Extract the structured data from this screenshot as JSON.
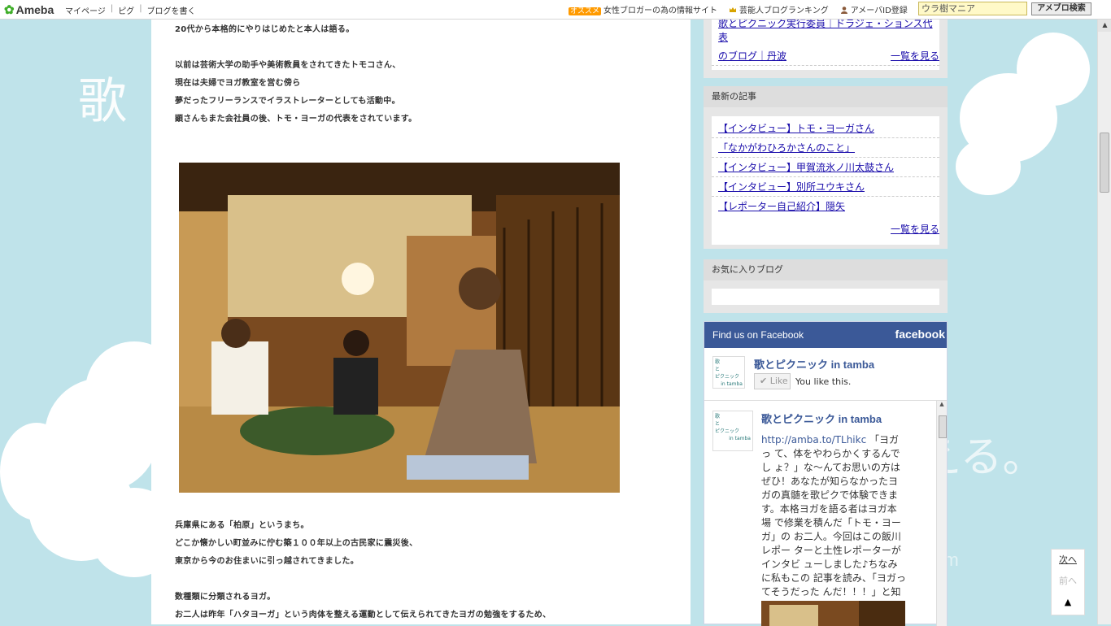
{
  "topbar": {
    "logo": "Ameba",
    "nav": [
      "マイページ",
      "ピグ",
      "ブログを書く"
    ],
    "links": [
      {
        "badge": "オススメ",
        "label": "女性ブロガーの為の情報サイト"
      },
      {
        "icon": "crown-icon",
        "label": "芸能人ブログランキング"
      },
      {
        "icon": "user-icon",
        "label": "アメーバID登録"
      }
    ],
    "search_value": "ウラ樹マニア",
    "search_button": "アメブロ検索"
  },
  "article": {
    "lines_top": [
      "20代から本格的にやりはじめたと本人は語る。",
      "",
      "以前は芸術大学の助手や美術教員をされてきたトモコさん、",
      "現在は夫婦でヨガ教室を営む傍ら",
      "夢だったフリーランスでイラストレーターとしても活動中。",
      "顕さんもまた会社員の後、トモ・ヨーガの代表をされています。"
    ],
    "lines_bottom": [
      "兵庫県にある「柏原」というまち。",
      "どこか懐かしい町並みに佇む築１００年以上の古民家に震災後、",
      "東京から今のお住まいに引っ越されてきました。",
      "",
      "数種類に分類されるヨガ。",
      "お二人は昨年「ハタヨーガ」という肉体を整える運動として伝えられてきたヨガの勉強をするため、"
    ]
  },
  "sidebar": {
    "top_links": [
      "歌とピクニック実行委員｜ドラジェ・ションス代表",
      "のブログ｜丹波"
    ],
    "top_more": "一覧を見る",
    "latest_title": "最新の記事",
    "latest": [
      "【インタビュー】トモ・ヨーガさん",
      "「なかがわひろかさんのこと」",
      "【インタビュー】甲賀流氷ノ川太鼓さん",
      "【インタビュー】別所ユウキさん",
      "【レポーター自己紹介】隠矢"
    ],
    "latest_more": "一覧を見る",
    "fav_title": "お気に入りブログ"
  },
  "facebook": {
    "header": "Find us on Facebook",
    "logo": "facebook",
    "page_name": "歌とピクニック in tamba",
    "like": "Like",
    "you_like": "You like this.",
    "thumb_text": [
      "歌",
      "と",
      "ピクニック",
      "in tamba"
    ],
    "post_name": "歌とピクニック in tamba",
    "post_url": "http://amba.to/TLhikc",
    "post_text": "「ヨガっ て、体をやわらかくするんでし ょ？」な〜んてお思いの方は ぜひ！あなたが知らなかったヨ ガの真髄を歌ピクで体験できま す。本格ヨガを語る者はヨガ本場 で修業を積んだ「トモ・ヨーガ」の お二人。今回はこの飯川レポー ターと土性レポーターがインタビ ューしました♪ちなみに私もこの 記事を読み、「ヨガってそうだった んだ！！！」と知りました♪"
  },
  "floatnav": {
    "next": "次へ",
    "prev": "前へ",
    "top": "▲"
  },
  "background": {
    "char_large": "歌",
    "faint": "生歌がきこえる。",
    "url": "c.com"
  },
  "colors": {
    "bg": "#bfe3ea",
    "fb_blue": "#3b5998",
    "link": "#1a0dab"
  }
}
